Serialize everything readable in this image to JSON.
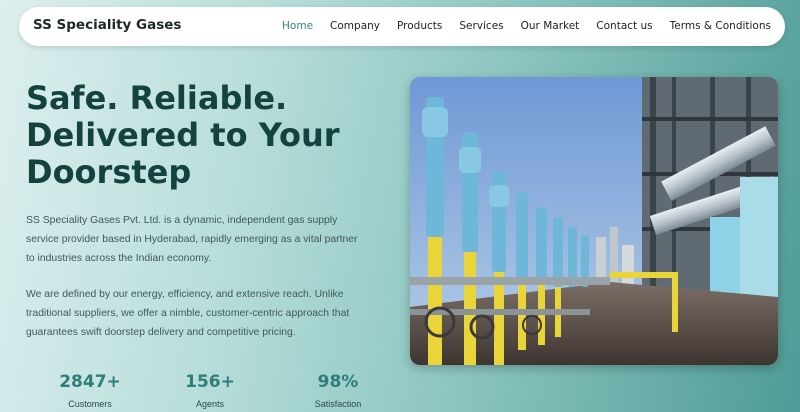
{
  "navbar": {
    "brand": "SS Speciality Gases",
    "links": [
      {
        "label": "Home",
        "active": true
      },
      {
        "label": "Company",
        "active": false
      },
      {
        "label": "Products",
        "active": false
      },
      {
        "label": "Services",
        "active": false
      },
      {
        "label": "Our Market",
        "active": false
      },
      {
        "label": "Contact us",
        "active": false
      },
      {
        "label": "Terms & Conditions",
        "active": false
      }
    ]
  },
  "hero": {
    "headline_lines": [
      "Safe. Reliable.",
      "Delivered to Your",
      "Doorstep"
    ],
    "paragraph1": "SS Speciality Gases Pvt. Ltd. is a dynamic, independent gas supply service provider based in Hyderabad, rapidly emerging as a vital partner to industries across the Indian economy.",
    "paragraph2": "We are defined by our energy, efficiency, and extensive reach. Unlike traditional suppliers, we offer a nimble, customer-centric approach that guarantees swift doorstep delivery and competitive pricing.",
    "image_icon": "industrial-pipeline-photo"
  },
  "stats": [
    {
      "value": "2847+",
      "label": "Customers"
    },
    {
      "value": "156+",
      "label": "Agents"
    },
    {
      "value": "98%",
      "label": "Satisfaction"
    }
  ],
  "colors": {
    "accent": "#2f8a86",
    "heading": "#14423f",
    "background_start": "#dcefee",
    "background_end": "#4f9b96"
  }
}
